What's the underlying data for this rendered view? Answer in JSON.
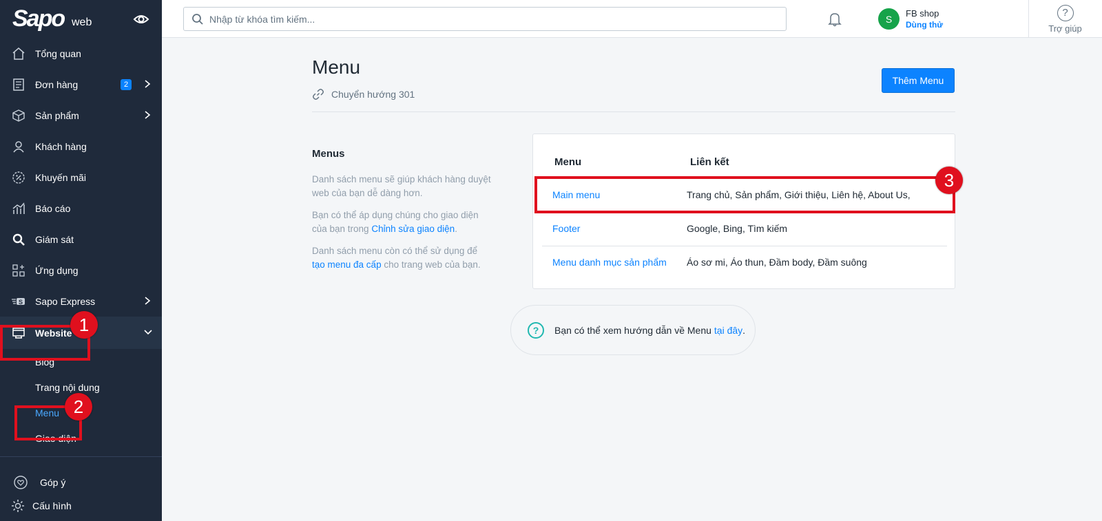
{
  "sidebar": {
    "brand": "Sapo",
    "brand_sub": "web",
    "items": [
      {
        "label": "Tổng quan",
        "icon": "home-icon"
      },
      {
        "label": "Đơn hàng",
        "icon": "order-icon",
        "badge": "2"
      },
      {
        "label": "Sản phẩm",
        "icon": "box-icon"
      },
      {
        "label": "Khách hàng",
        "icon": "user-icon"
      },
      {
        "label": "Khuyến mãi",
        "icon": "discount-icon"
      },
      {
        "label": "Báo cáo",
        "icon": "chart-icon"
      },
      {
        "label": "Giám sát",
        "icon": "search-icon"
      },
      {
        "label": "Ứng dụng",
        "icon": "apps-icon"
      },
      {
        "label": "Sapo Express",
        "icon": "express-icon"
      },
      {
        "label": "Website",
        "icon": "website-icon"
      }
    ],
    "website_sub": [
      "Blog",
      "Trang nội dung",
      "Menu",
      "Giao diện"
    ],
    "feedback": "Góp ý",
    "settings": "Cấu hình"
  },
  "topbar": {
    "search_placeholder": "Nhập từ khóa tìm kiếm...",
    "avatar_letter": "S",
    "shop_name": "FB shop",
    "trial_label": "Dùng thử",
    "help_icon": "?",
    "help_label": "Trợ giúp"
  },
  "main": {
    "title": "Menu",
    "redirect_label": "Chuyển hướng 301",
    "add_button": "Thêm Menu",
    "section_title": "Menus",
    "desc1": "Danh sách menu sẽ giúp khách hàng duyệt web của bạn dễ dàng hơn.",
    "desc2_prefix": "Bạn có thể áp dụng chúng cho giao diện của bạn trong ",
    "desc2_link": "Chỉnh sửa giao diện",
    "desc2_suffix": ".",
    "desc3_prefix": "Danh sách menu còn có thể sử dụng để ",
    "desc3_link": "tạo menu đa cấp",
    "desc3_suffix": " cho trang web của bạn.",
    "table": {
      "headers": [
        "Menu",
        "Liên kết"
      ],
      "rows": [
        {
          "name": "Main menu",
          "links": "Trang chủ, Sản phẩm, Giới thiệu, Liên hệ, About Us,"
        },
        {
          "name": "Footer",
          "links": "Google, Bing, Tìm kiếm"
        },
        {
          "name": "Menu danh mục sản phẩm",
          "links": "Áo sơ mi, Áo thun, Đầm body, Đầm suông"
        }
      ]
    },
    "tip_icon": "?",
    "tip_text": "Bạn có thể xem hướng dẫn về Menu",
    "tip_link": "tại đây",
    "tip_suffix": "."
  },
  "annotations": [
    "1",
    "2",
    "3"
  ],
  "colors": {
    "sidebar": "#1f2a3b",
    "accent": "#0c83ff",
    "annotation": "#e0101e",
    "avatar": "#16a34a"
  }
}
